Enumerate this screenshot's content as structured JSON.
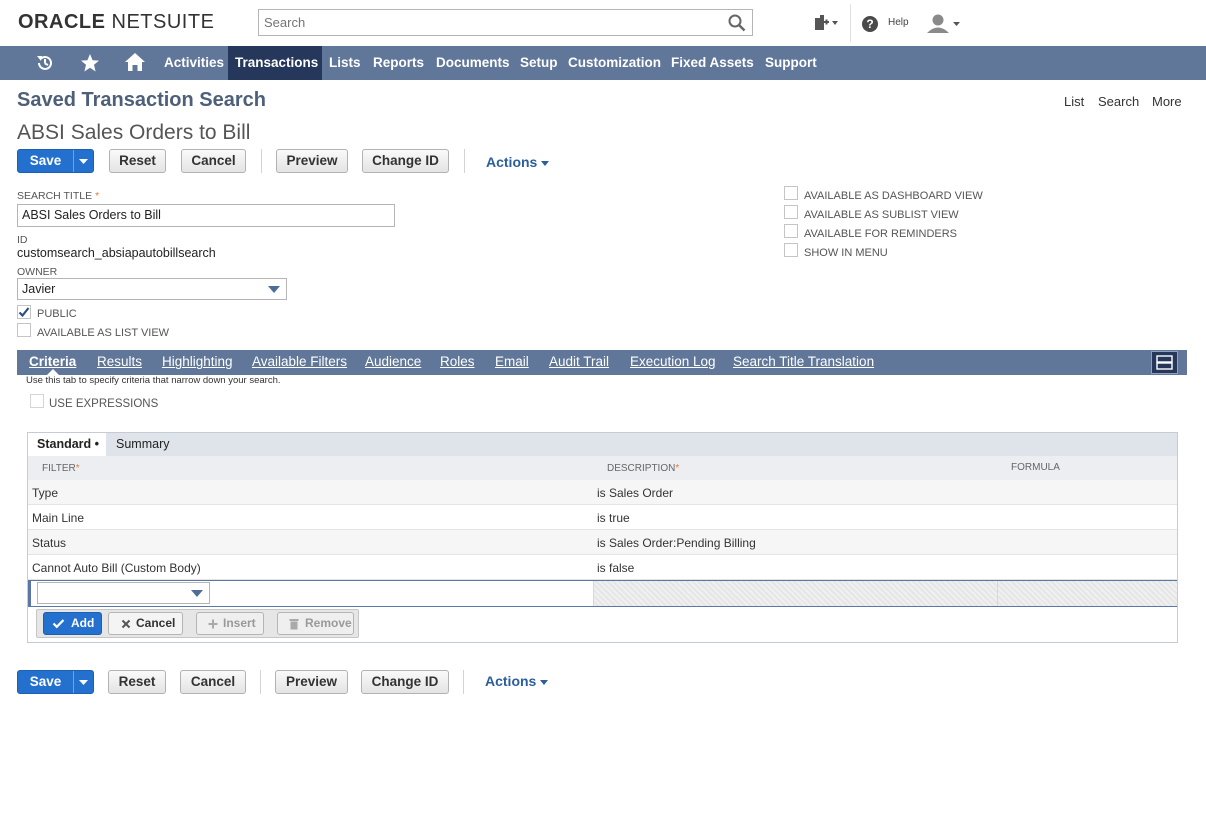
{
  "brand": {
    "name_bold": "ORACLE",
    "name_light": "NETSUITE"
  },
  "global_search": {
    "placeholder": "Search"
  },
  "header": {
    "help_label": "Help"
  },
  "nav": {
    "items": [
      "Activities",
      "Transactions",
      "Lists",
      "Reports",
      "Documents",
      "Setup",
      "Customization",
      "Fixed Assets",
      "Support"
    ],
    "active": "Transactions"
  },
  "page": {
    "title": "Saved Transaction Search",
    "record_title": "ABSI Sales Orders to Bill",
    "links": [
      "List",
      "Search",
      "More"
    ]
  },
  "buttons": {
    "save": "Save",
    "reset": "Reset",
    "cancel": "Cancel",
    "preview": "Preview",
    "change_id": "Change ID",
    "actions": "Actions"
  },
  "form": {
    "search_title_label": "SEARCH TITLE",
    "search_title_value": "ABSI Sales Orders to Bill",
    "id_label": "ID",
    "id_value": "customsearch_absiapautobillsearch",
    "owner_label": "OWNER",
    "owner_value": "Javier",
    "public_label": "PUBLIC",
    "public_checked": true,
    "list_view_label": "AVAILABLE AS LIST VIEW",
    "right_checks": [
      "AVAILABLE AS DASHBOARD VIEW",
      "AVAILABLE AS SUBLIST VIEW",
      "AVAILABLE FOR REMINDERS",
      "SHOW IN MENU"
    ]
  },
  "subtabs": {
    "items": [
      "Criteria",
      "Results",
      "Highlighting",
      "Available Filters",
      "Audience",
      "Roles",
      "Email",
      "Audit Trail",
      "Execution Log",
      "Search Title Translation"
    ],
    "active": "Criteria",
    "hint": "Use this tab to specify criteria that narrow down your search."
  },
  "criteria": {
    "use_expressions_label": "USE EXPRESSIONS",
    "tabs": [
      "Standard •",
      "Summary"
    ],
    "columns": [
      "FILTER",
      "DESCRIPTION",
      "FORMULA"
    ],
    "rows": [
      {
        "filter": "Type",
        "description": "is Sales Order"
      },
      {
        "filter": "Main Line",
        "description": "is true"
      },
      {
        "filter": "Status",
        "description": "is Sales Order:Pending Billing"
      },
      {
        "filter": "Cannot Auto Bill (Custom Body)",
        "description": "is false"
      }
    ],
    "machine_buttons": {
      "add": "Add",
      "cancel": "Cancel",
      "insert": "Insert",
      "remove": "Remove"
    }
  },
  "colors": {
    "nav_bg": "#607799",
    "nav_active": "#25375a",
    "primary": "#2470cf",
    "title": "#4d5f79",
    "link": "#2b5e9a"
  }
}
